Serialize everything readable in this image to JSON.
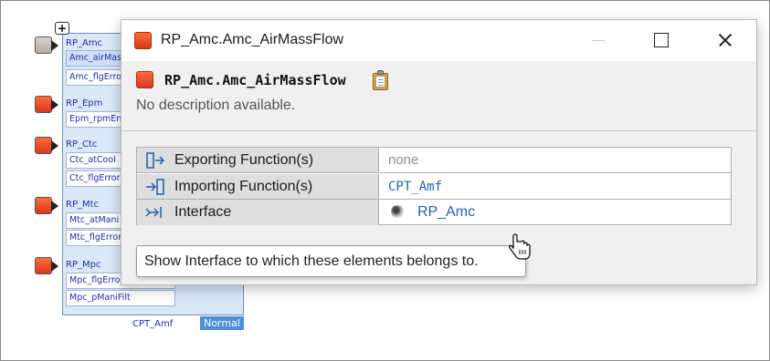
{
  "diagram": {
    "ports": [
      {
        "label": "RP_Amc",
        "fields": [
          "Amc_airMass",
          "Amc_flgError"
        ],
        "style": "grey"
      },
      {
        "label": "RP_Epm",
        "fields": [
          "Epm_rpmEng"
        ],
        "style": "red"
      },
      {
        "label": "RP_Ctc",
        "fields": [
          "Ctc_atCool",
          "Ctc_flgError"
        ],
        "style": "red"
      },
      {
        "label": "RP_Mtc",
        "fields": [
          "Mtc_atMani",
          "Mtc_flgError"
        ],
        "style": "red"
      },
      {
        "label": "RP_Mpc",
        "fields": [
          "Mpc_flgError",
          "Mpc_pManiFilt"
        ],
        "style": "red"
      }
    ],
    "component_label": "CPT_Amf",
    "badge": "Normal",
    "add_symbol": "+"
  },
  "popup": {
    "window_title": "RP_Amc.Amc_AirMassFlow",
    "header_name": "RP_Amc.Amc_AirMassFlow",
    "description": "No description available.",
    "rows": [
      {
        "label": "Exporting Function(s)",
        "value": "none",
        "icon": "export-arrow-icon"
      },
      {
        "label": "Importing Function(s)",
        "value": "CPT_Amf",
        "icon": "import-arrow-icon"
      },
      {
        "label": "Interface",
        "value": "RP_Amc",
        "icon": "interface-arrow-icon"
      }
    ],
    "tooltip": "Show Interface to which these elements belongs to."
  },
  "colors": {
    "accent_red": "#e14a24",
    "link_blue": "#2065b0",
    "badge_blue": "#4f8fd6"
  }
}
